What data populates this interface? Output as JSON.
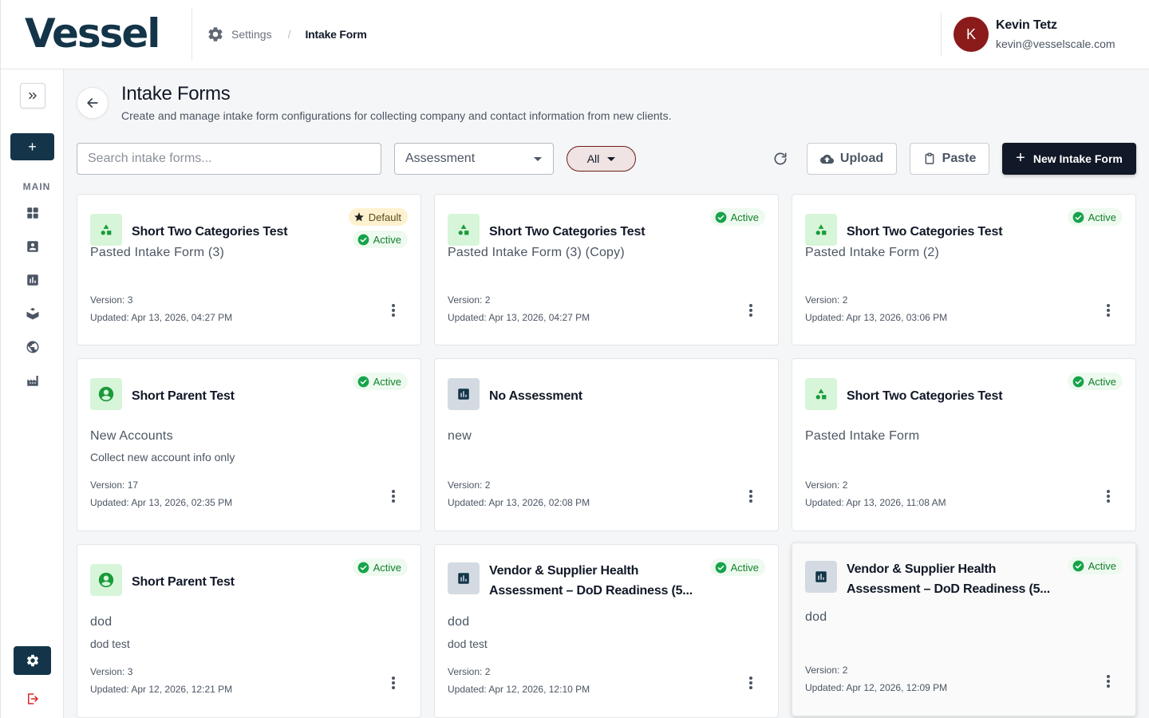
{
  "header": {
    "logo": "Vessel",
    "breadcrumb": [
      "Settings",
      "Intake Form"
    ],
    "user": {
      "initial": "K",
      "name": "Kevin Tetz",
      "email": "kevin@vesselscale.com"
    }
  },
  "sidebar": {
    "section_label": "MAIN",
    "add_label": "+",
    "icons": [
      "dashboard-icon",
      "contacts-icon",
      "chart-icon",
      "hands-icon",
      "globe-icon",
      "factory-icon"
    ]
  },
  "page": {
    "title": "Intake Forms",
    "subtitle": "Create and manage intake form configurations for collecting company and contact information from new clients."
  },
  "toolbar": {
    "search_placeholder": "Search intake forms...",
    "filter_value": "Assessment",
    "status_filter": "All",
    "upload_label": "Upload",
    "paste_label": "Paste",
    "new_label": "New Intake Form"
  },
  "badges": {
    "active": "Active",
    "default": "Default"
  },
  "cards": [
    {
      "title": "Short Two Categories Test",
      "name": "Pasted Intake Form (3)",
      "description": "",
      "version": "Version: 3",
      "updated": "Updated: Apr 13, 2026, 04:27 PM",
      "icon": "shapes-icon",
      "is_default": true,
      "is_active": true
    },
    {
      "title": "Short Two Categories Test",
      "name": "Pasted Intake Form (3) (Copy)",
      "description": "",
      "version": "Version: 2",
      "updated": "Updated: Apr 13, 2026, 04:27 PM",
      "icon": "shapes-icon",
      "is_default": false,
      "is_active": true
    },
    {
      "title": "Short Two Categories Test",
      "name": "Pasted Intake Form (2)",
      "description": "",
      "version": "Version: 2",
      "updated": "Updated: Apr 13, 2026, 03:06 PM",
      "icon": "shapes-icon",
      "is_default": false,
      "is_active": true
    },
    {
      "title": "Short Parent Test",
      "name": "New Accounts",
      "description": "Collect new account info only",
      "version": "Version: 17",
      "updated": "Updated: Apr 13, 2026, 02:35 PM",
      "icon": "account-icon",
      "is_default": false,
      "is_active": true
    },
    {
      "title": "No Assessment",
      "name": "new",
      "description": "",
      "version": "Version: 2",
      "updated": "Updated: Apr 13, 2026, 02:08 PM",
      "icon": "bar-chart-icon",
      "is_default": false,
      "is_active": false
    },
    {
      "title": "Short Two Categories Test",
      "name": "Pasted Intake Form",
      "description": "",
      "version": "Version: 2",
      "updated": "Updated: Apr 13, 2026, 11:08 AM",
      "icon": "shapes-icon",
      "is_default": false,
      "is_active": true
    },
    {
      "title": "Short Parent Test",
      "name": "dod",
      "description": "dod test",
      "version": "Version: 3",
      "updated": "Updated: Apr 12, 2026, 12:21 PM",
      "icon": "account-icon",
      "is_default": false,
      "is_active": true
    },
    {
      "title": "Vendor & Supplier Health Assessment – DoD Readiness (5...",
      "name": "dod",
      "description": "dod test",
      "version": "Version: 2",
      "updated": "Updated: Apr 12, 2026, 12:10 PM",
      "icon": "bar-chart-icon",
      "is_default": false,
      "is_active": true
    },
    {
      "title": "Vendor & Supplier Health Assessment – DoD Readiness (5...",
      "name": "dod",
      "description": "",
      "version": "Version: 2",
      "updated": "Updated: Apr 12, 2026, 12:09 PM",
      "icon": "bar-chart-icon",
      "is_default": false,
      "is_active": true
    }
  ],
  "colors": {
    "brand": "#143549",
    "active": "#13802b",
    "active_bg": "#eefaf0",
    "default_bg": "#fdf1cf",
    "primary_button": "#111827"
  }
}
